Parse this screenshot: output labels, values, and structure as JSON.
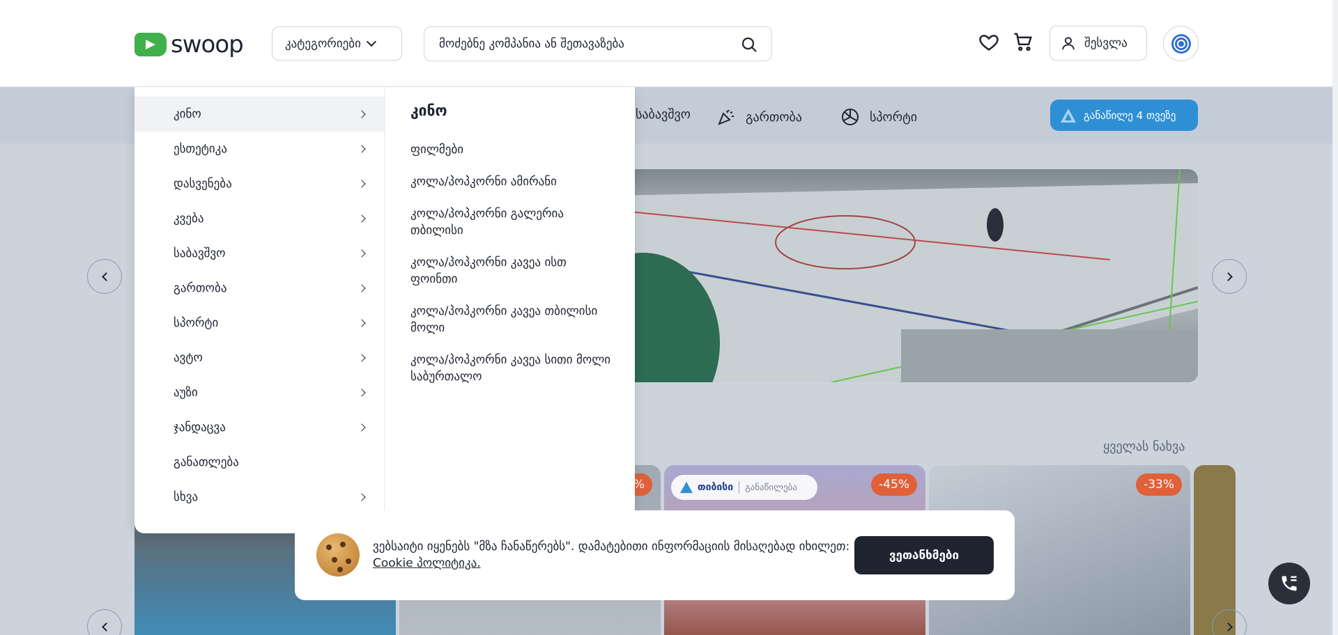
{
  "header": {
    "logo_text": "swoop",
    "categories_label": "კატეგორიები",
    "search_placeholder": "მოძებნე კომპანია ან შეთავაზება",
    "login_label": "შესვლა"
  },
  "nav": {
    "items": [
      {
        "label": "საბავშვო",
        "icon": "toy-icon"
      },
      {
        "label": "გართობა",
        "icon": "party-popper-icon"
      },
      {
        "label": "სპორტი",
        "icon": "ball-icon"
      }
    ],
    "promo_label": "განაწილე 4 თვეზე"
  },
  "dropdown": {
    "categories": [
      {
        "label": "კინო",
        "has_arrow": true,
        "active": true
      },
      {
        "label": "ესთეტიკა",
        "has_arrow": true
      },
      {
        "label": "დასვენება",
        "has_arrow": true
      },
      {
        "label": "კვება",
        "has_arrow": true
      },
      {
        "label": "საბავშვო",
        "has_arrow": true
      },
      {
        "label": "გართობა",
        "has_arrow": true
      },
      {
        "label": "სპორტი",
        "has_arrow": true
      },
      {
        "label": "ავტო",
        "has_arrow": true
      },
      {
        "label": "აუზი",
        "has_arrow": true
      },
      {
        "label": "ჯანდაცვა",
        "has_arrow": true
      },
      {
        "label": "განათლება",
        "has_arrow": false
      },
      {
        "label": "სხვა",
        "has_arrow": true
      }
    ],
    "sub_title": "კინო",
    "sub_items": [
      "ფილმები",
      "კოლა/პოპკორნი ამირანი",
      "კოლა/პოპკორნი გალერია თბილისი",
      "კოლა/პოპკორნი კავეა ისთ ფოინთი",
      "კოლა/პოპკორნი კავეა თბილისი მოლი",
      "კოლა/პოპკორნი კავეა სითი მოლი საბურთალო"
    ]
  },
  "main": {
    "see_all": "ყველას ნახვა",
    "cards": [
      {
        "discount": ""
      },
      {
        "discount": "%"
      },
      {
        "discount": "-45%",
        "partner": "თიბისი",
        "partner_plan": "განაწილება"
      },
      {
        "discount": "-33%"
      }
    ]
  },
  "cookie": {
    "text": "ვებსაიტი იყენებს \"მზა ჩანაწერებს\". დამატებითი ინფორმაციის მისაღებად იხილეთ:",
    "link": "Cookie პოლიტიკა.",
    "button": "ვეთანხმები"
  },
  "colors": {
    "brand_green": "#3fb04b",
    "promo_blue": "#2f8fd4",
    "discount_orange": "#e0603a",
    "dark": "#1f2430"
  }
}
